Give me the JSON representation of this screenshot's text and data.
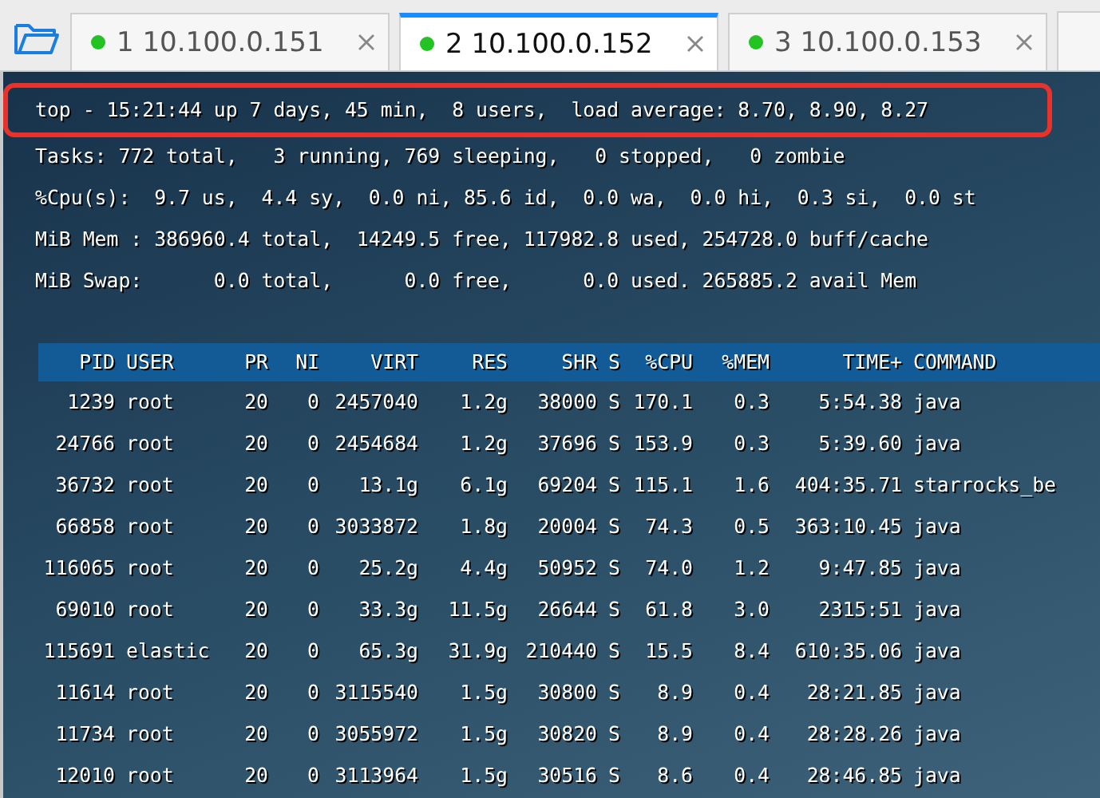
{
  "tabs": [
    {
      "number": "1",
      "host": "10.100.0.151",
      "selected": false,
      "connected": true
    },
    {
      "number": "2",
      "host": "10.100.0.152",
      "selected": true,
      "connected": true
    },
    {
      "number": "3",
      "host": "10.100.0.153",
      "selected": false,
      "connected": true
    }
  ],
  "summary": [
    {
      "text": "top - 15:21:44 up 7 days, 45 min,  8 users,  load average: 8.70, 8.90, 8.27",
      "highlighted": true
    },
    {
      "text": "Tasks: 772 total,   3 running, 769 sleeping,   0 stopped,   0 zombie",
      "highlighted": false
    },
    {
      "text": "%Cpu(s):  9.7 us,  4.4 sy,  0.0 ni, 85.6 id,  0.0 wa,  0.0 hi,  0.3 si,  0.0 st",
      "highlighted": false
    },
    {
      "text": "MiB Mem : 386960.4 total,  14249.5 free, 117982.8 used, 254728.0 buff/cache",
      "highlighted": false
    },
    {
      "text": "MiB Swap:      0.0 total,      0.0 free,      0.0 used. 265885.2 avail Mem",
      "highlighted": false
    }
  ],
  "table": {
    "columns": [
      "PID",
      "USER",
      "PR",
      "NI",
      "VIRT",
      "RES",
      "SHR",
      "S",
      "%CPU",
      "%MEM",
      "TIME+",
      "COMMAND"
    ],
    "rows": [
      [
        "1239",
        "root",
        "20",
        "0",
        "2457040",
        "1.2g",
        "38000",
        "S",
        "170.1",
        "0.3",
        "5:54.38",
        "java"
      ],
      [
        "24766",
        "root",
        "20",
        "0",
        "2454684",
        "1.2g",
        "37696",
        "S",
        "153.9",
        "0.3",
        "5:39.60",
        "java"
      ],
      [
        "36732",
        "root",
        "20",
        "0",
        "13.1g",
        "6.1g",
        "69204",
        "S",
        "115.1",
        "1.6",
        "404:35.71",
        "starrocks_be"
      ],
      [
        "66858",
        "root",
        "20",
        "0",
        "3033872",
        "1.8g",
        "20004",
        "S",
        "74.3",
        "0.5",
        "363:10.45",
        "java"
      ],
      [
        "116065",
        "root",
        "20",
        "0",
        "25.2g",
        "4.4g",
        "50952",
        "S",
        "74.0",
        "1.2",
        "9:47.85",
        "java"
      ],
      [
        "69010",
        "root",
        "20",
        "0",
        "33.3g",
        "11.5g",
        "26644",
        "S",
        "61.8",
        "3.0",
        "2315:51",
        "java"
      ],
      [
        "115691",
        "elastic",
        "20",
        "0",
        "65.3g",
        "31.9g",
        "210440",
        "S",
        "15.5",
        "8.4",
        "610:35.06",
        "java"
      ],
      [
        "11614",
        "root",
        "20",
        "0",
        "3115540",
        "1.5g",
        "30800",
        "S",
        "8.9",
        "0.4",
        "28:21.85",
        "java"
      ],
      [
        "11734",
        "root",
        "20",
        "0",
        "3055972",
        "1.5g",
        "30820",
        "S",
        "8.9",
        "0.4",
        "28:28.26",
        "java"
      ],
      [
        "12010",
        "root",
        "20",
        "0",
        "3113964",
        "1.5g",
        "30516",
        "S",
        "8.6",
        "0.4",
        "28:46.85",
        "java"
      ]
    ]
  }
}
